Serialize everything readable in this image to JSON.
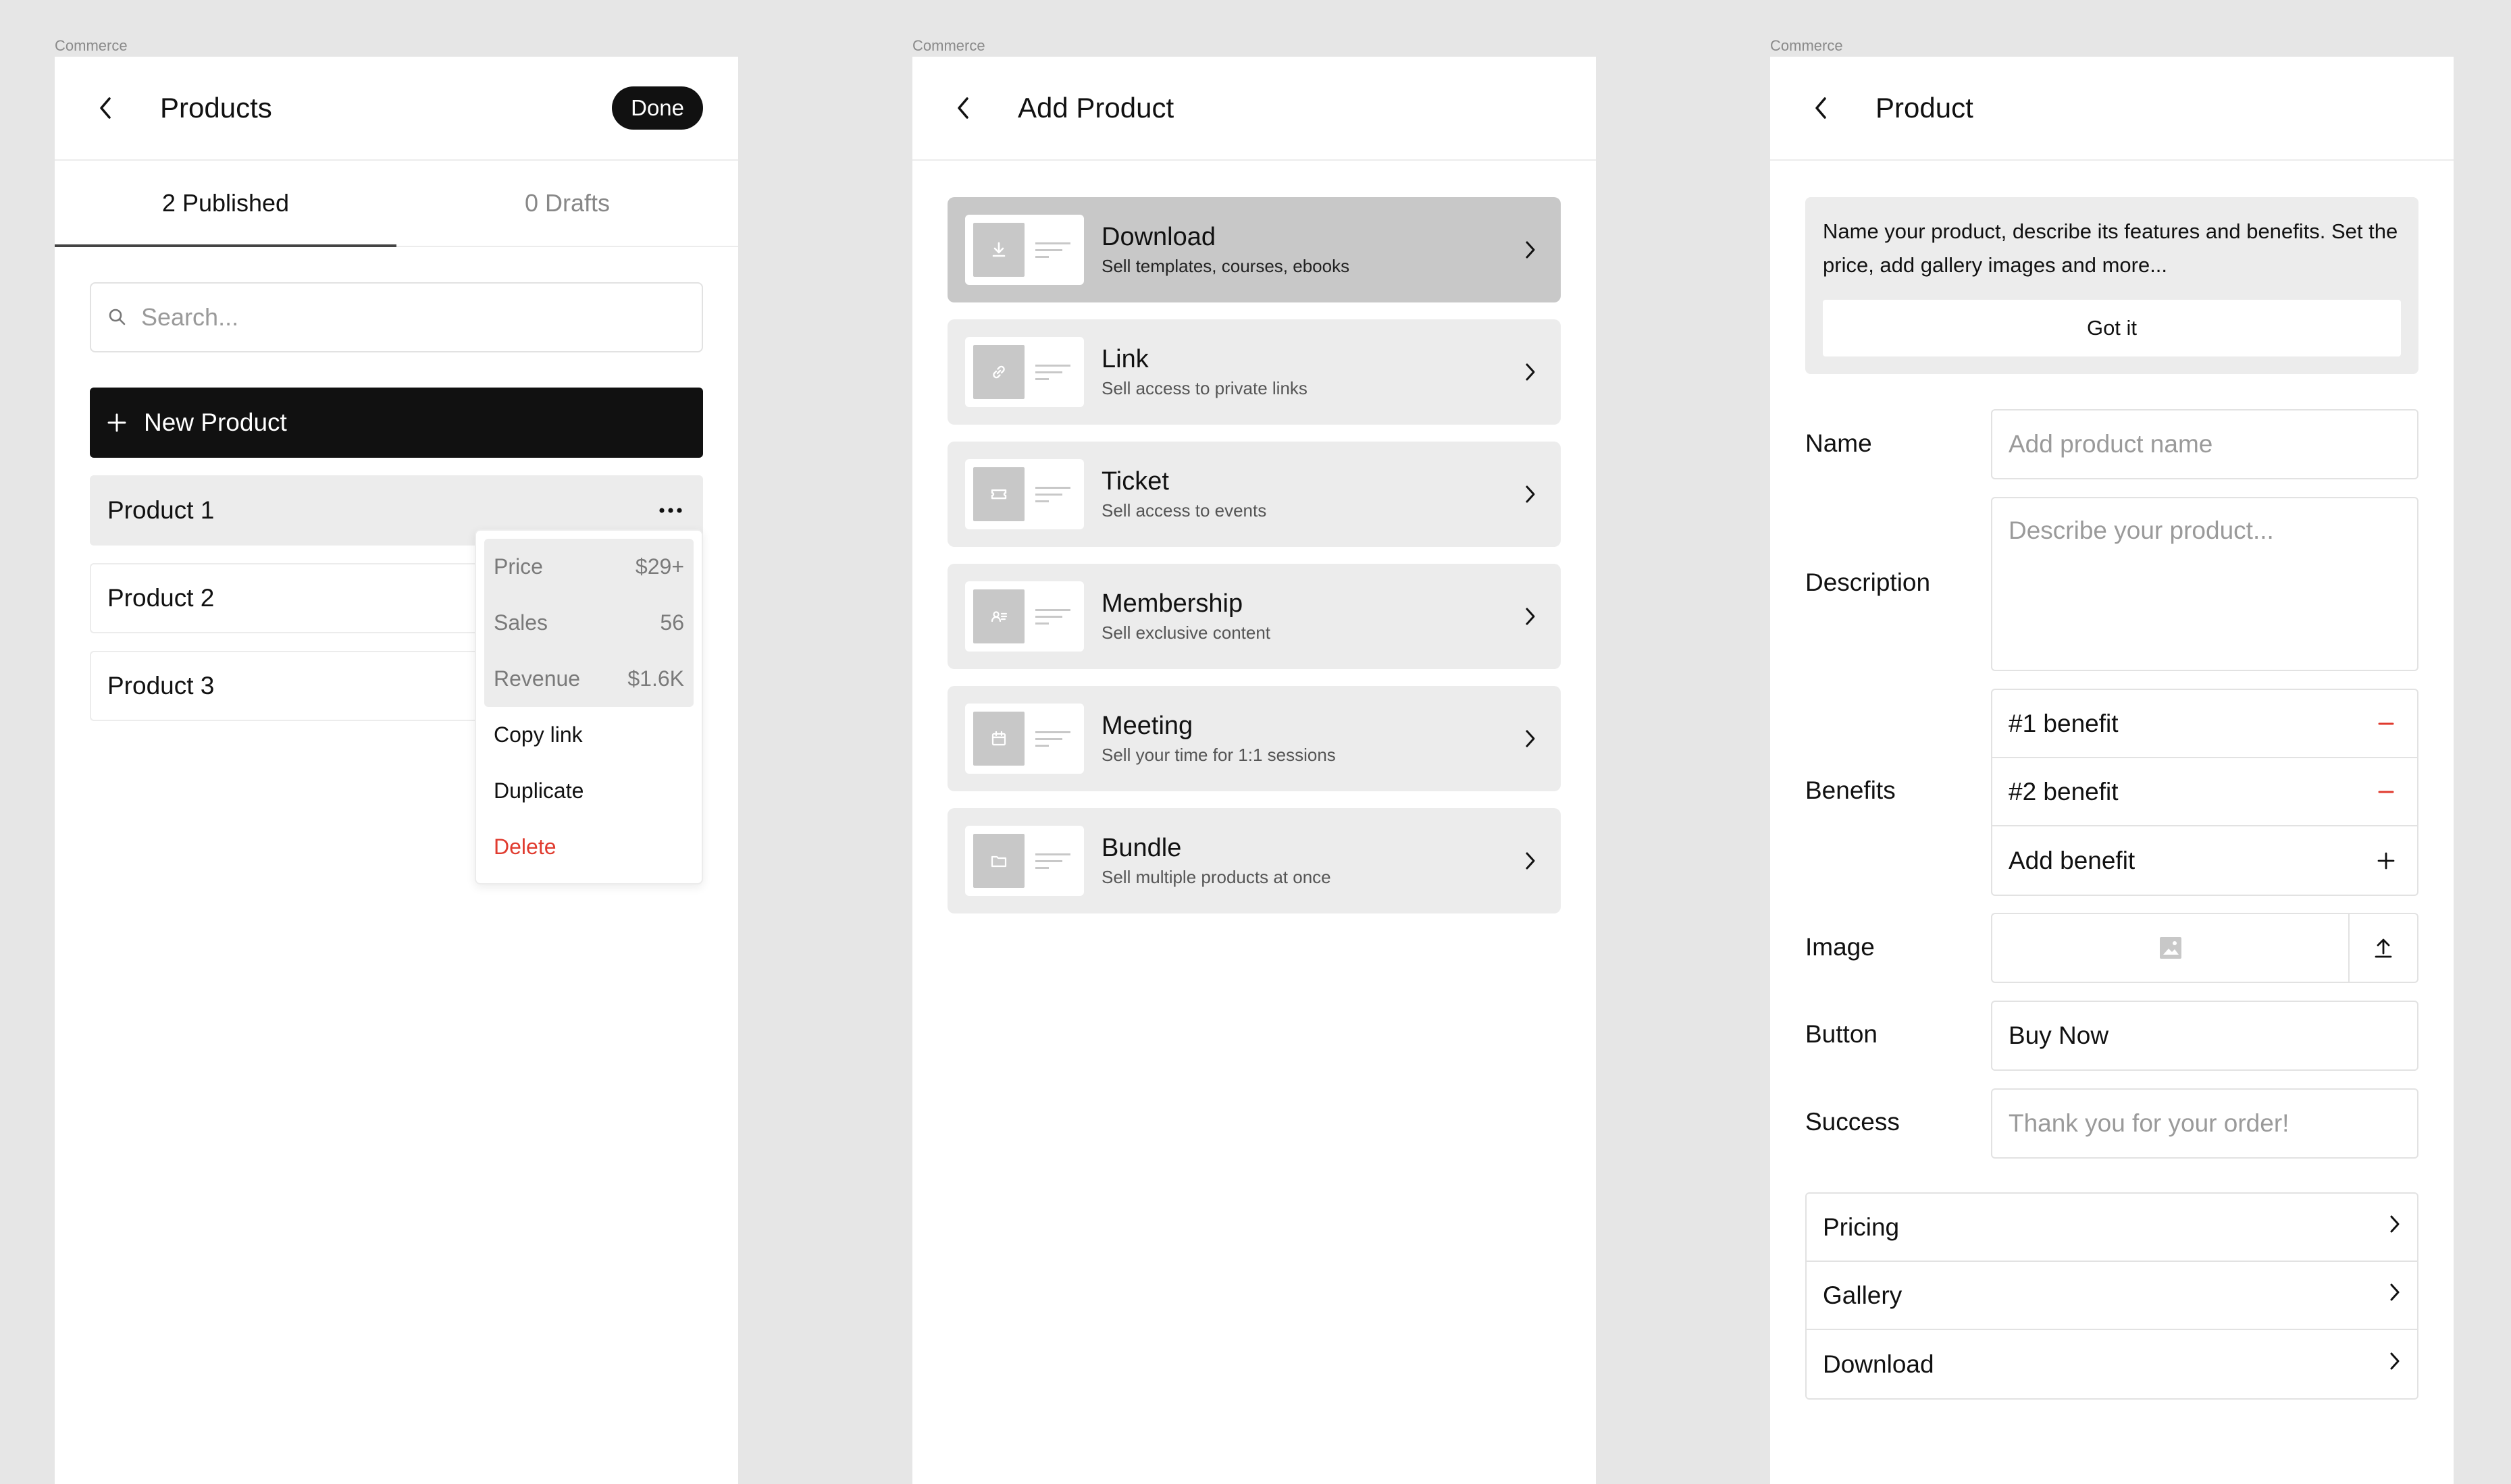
{
  "frame_label": "Commerce",
  "colors": {
    "accent": "#111111",
    "danger": "#e03b2f",
    "surface": "#ececec",
    "selected": "#c8c8c8"
  },
  "products_screen": {
    "title": "Products",
    "done_label": "Done",
    "tabs": [
      {
        "label": "2 Published",
        "active": true
      },
      {
        "label": "0 Drafts",
        "active": false
      }
    ],
    "search_placeholder": "Search...",
    "new_product_label": "New Product",
    "products": [
      "Product 1",
      "Product 2",
      "Product 3"
    ],
    "menu": {
      "stats": [
        {
          "label": "Price",
          "value": "$29+"
        },
        {
          "label": "Sales",
          "value": "56"
        },
        {
          "label": "Revenue",
          "value": "$1.6K"
        }
      ],
      "actions": [
        "Copy link",
        "Duplicate",
        "Delete"
      ]
    }
  },
  "add_product_screen": {
    "title": "Add Product",
    "types": [
      {
        "title": "Download",
        "subtitle": "Sell templates, courses, ebooks",
        "icon": "download-icon",
        "selected": true
      },
      {
        "title": "Link",
        "subtitle": "Sell access to private links",
        "icon": "link-icon",
        "selected": false
      },
      {
        "title": "Ticket",
        "subtitle": "Sell access to events",
        "icon": "ticket-icon",
        "selected": false
      },
      {
        "title": "Membership",
        "subtitle": "Sell exclusive content",
        "icon": "membership-icon",
        "selected": false
      },
      {
        "title": "Meeting",
        "subtitle": "Sell your time for 1:1 sessions",
        "icon": "calendar-icon",
        "selected": false
      },
      {
        "title": "Bundle",
        "subtitle": "Sell multiple products at once",
        "icon": "folder-icon",
        "selected": false
      }
    ]
  },
  "product_screen": {
    "title": "Product",
    "tip_text": "Name your product, describe its features and benefits. Set the price, add gallery images and more...",
    "got_it_label": "Got it",
    "name_label": "Name",
    "name_placeholder": "Add product name",
    "description_label": "Description",
    "description_placeholder": "Describe your product...",
    "benefits_label": "Benefits",
    "benefits": [
      "#1 benefit",
      "#2 benefit"
    ],
    "add_benefit_label": "Add benefit",
    "image_label": "Image",
    "button_label": "Button",
    "button_value": "Buy Now",
    "success_label": "Success",
    "success_placeholder": "Thank you for your order!",
    "nav_items": [
      "Pricing",
      "Gallery",
      "Download"
    ]
  }
}
